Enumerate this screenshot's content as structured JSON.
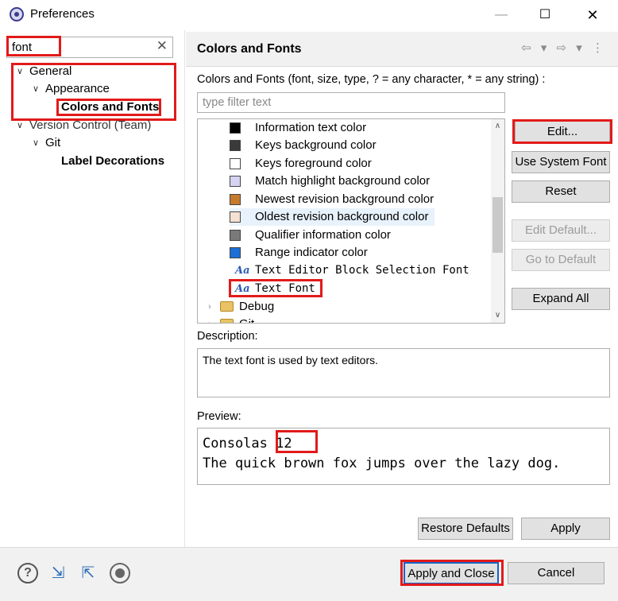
{
  "window": {
    "title": "Preferences",
    "minimize_glyph": "—",
    "maximize_glyph": "☐",
    "close_glyph": "✕"
  },
  "search": {
    "value": "font",
    "clear_glyph": "✕"
  },
  "tree": {
    "items": [
      {
        "label": "General",
        "chevron": "∨"
      },
      {
        "label": "Appearance",
        "chevron": "∨"
      },
      {
        "label": "Colors and Fonts",
        "chevron": ""
      },
      {
        "label": "Version Control (Team)",
        "chevron": "∨"
      },
      {
        "label": "Git",
        "chevron": "∨"
      },
      {
        "label": "Label Decorations",
        "chevron": ""
      }
    ]
  },
  "page": {
    "title": "Colors and Fonts",
    "nav_icons": "⇦ ▾ ⇨ ▾ ⋮",
    "description_line": "Colors and Fonts (font, size, type, ? = any character, * = any string) :",
    "filter_placeholder": "type filter text"
  },
  "list": {
    "items": [
      {
        "label": "Information text color",
        "kind": "color",
        "color": "#000000"
      },
      {
        "label": "Keys background color",
        "kind": "color",
        "color": "#3a3a3a"
      },
      {
        "label": "Keys foreground color",
        "kind": "color",
        "color": "#ffffff"
      },
      {
        "label": "Match highlight background color",
        "kind": "color",
        "color": "#d6d2f2"
      },
      {
        "label": "Newest revision background color",
        "kind": "color",
        "color": "#c57a2c"
      },
      {
        "label": "Oldest revision background color",
        "kind": "color",
        "color": "#f4e1d2"
      },
      {
        "label": "Qualifier information color",
        "kind": "color",
        "color": "#7a7a7a"
      },
      {
        "label": "Range indicator color",
        "kind": "color",
        "color": "#1c6fd6"
      },
      {
        "label": "Text Editor Block Selection Font",
        "kind": "font"
      },
      {
        "label": "Text Font",
        "kind": "font"
      },
      {
        "label": "Debug",
        "kind": "category"
      },
      {
        "label": "Git",
        "kind": "category"
      }
    ],
    "font_icon": "Aa",
    "collapsed_chevron": "›",
    "scroll_up": "∧",
    "scroll_down": "∨"
  },
  "buttons": {
    "edit": "Edit...",
    "use_system_font": "Use System Font",
    "reset": "Reset",
    "edit_default": "Edit Default...",
    "go_to_default": "Go to Default",
    "expand_all": "Expand All",
    "restore_defaults": "Restore Defaults",
    "apply": "Apply",
    "apply_and_close": "Apply and Close",
    "cancel": "Cancel"
  },
  "description": {
    "label": "Description:",
    "text": "The text font is used by text editors."
  },
  "preview": {
    "label": "Preview:",
    "font_name": "Consolas",
    "font_size": "12",
    "sample": "The quick brown fox jumps over the lazy dog."
  },
  "bottom_icons": {
    "help": "?",
    "import": "⇲",
    "export": "⇱"
  }
}
